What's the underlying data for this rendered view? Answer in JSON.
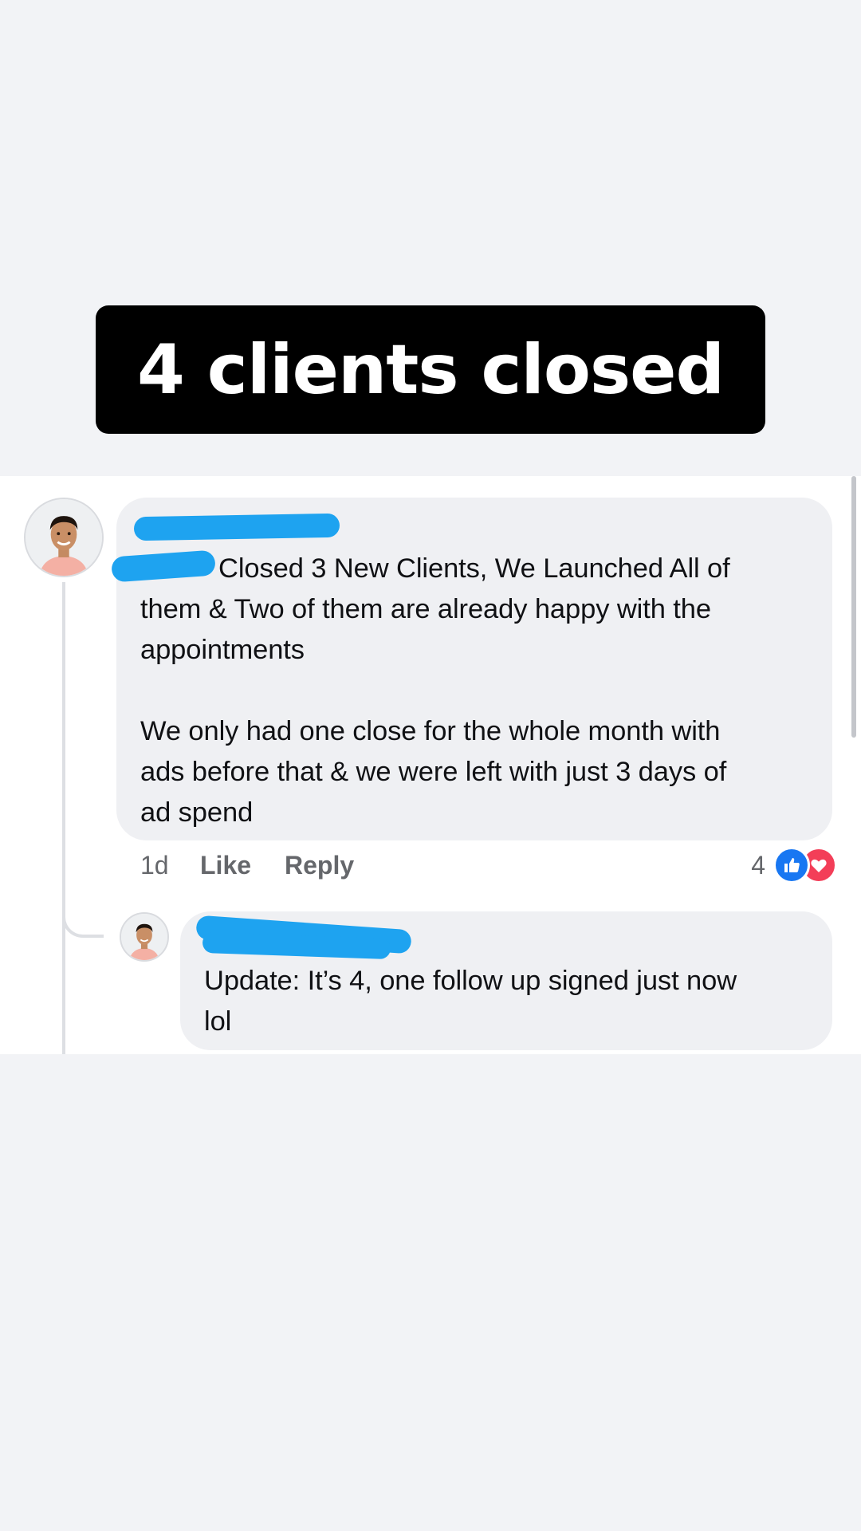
{
  "banner": {
    "text": "4 clients closed"
  },
  "comment": {
    "body_first_line": "Closed 3 New Clients, We Launched All of",
    "body_rest": "them & Two of them are already happy with the\nappointments\n\nWe only had one close for the whole month with\nads before that & we were left with just 3 days of\nad spend",
    "time": "1d",
    "like_label": "Like",
    "reply_label": "Reply",
    "reaction_count": "4",
    "reactions": [
      "like-icon",
      "love-icon"
    ]
  },
  "reply": {
    "body": "Update: It’s 4, one follow up signed just now\nlol"
  },
  "colors": {
    "redaction": "#1ea3f0",
    "bubble": "#eff0f3",
    "like": "#1877f2",
    "love": "#f33e58"
  }
}
